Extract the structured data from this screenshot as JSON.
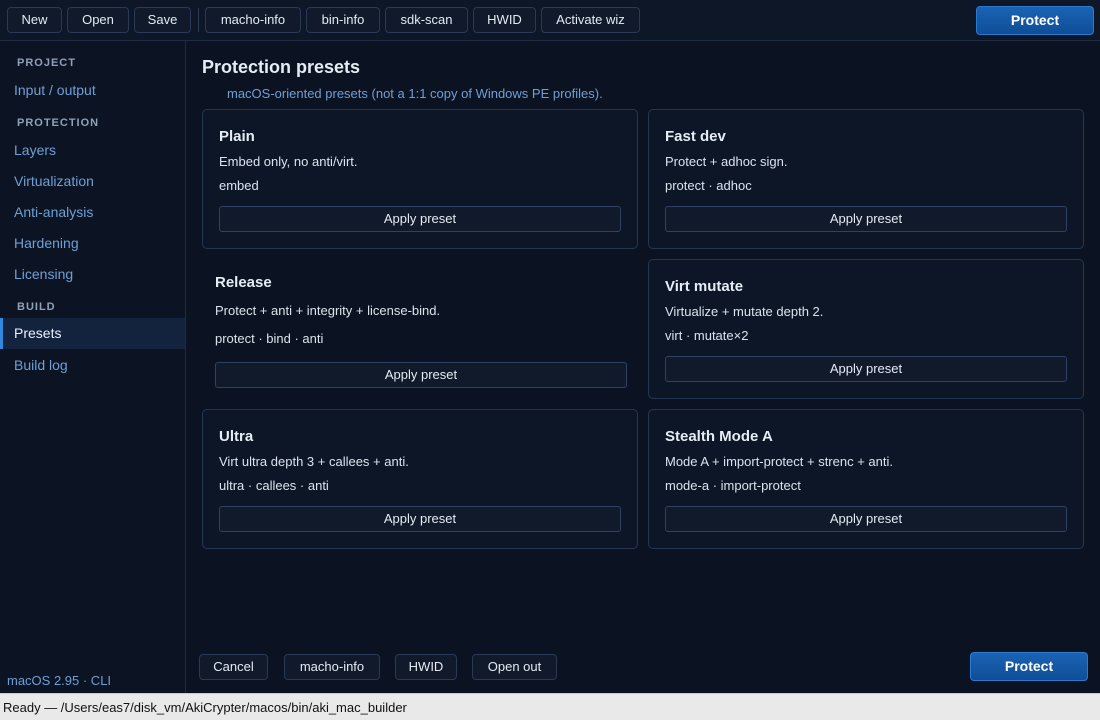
{
  "toolbar": {
    "buttons": [
      "New",
      "Open",
      "Save",
      "macho-info",
      "bin-info",
      "sdk-scan",
      "HWID",
      "Activate wiz"
    ],
    "protect_label": "Protect"
  },
  "sidebar": {
    "sections": [
      {
        "heading": "PROJECT",
        "items": [
          "Input / output"
        ]
      },
      {
        "heading": "PROTECTION",
        "items": [
          "Layers",
          "Virtualization",
          "Anti-analysis",
          "Hardening",
          "Licensing"
        ]
      },
      {
        "heading": "BUILD",
        "items": [
          "Presets",
          "Build log"
        ]
      }
    ],
    "active_item": "Presets",
    "version": "macOS 2.95 · CLI"
  },
  "main": {
    "title": "Protection presets",
    "subtitle": "macOS-oriented presets (not a 1:1 copy of Windows PE profiles).",
    "apply_label": "Apply preset",
    "presets": [
      {
        "name": "Plain",
        "description": "Embed only, no anti/virt.",
        "tags": "embed"
      },
      {
        "name": "Fast dev",
        "description": "Protect + adhoc sign.",
        "tags": "protect · adhoc"
      },
      {
        "name": "Release",
        "description": "Protect + anti + integrity + license-bind.",
        "tags": "protect · bind · anti"
      },
      {
        "name": "Virt mutate",
        "description": "Virtualize + mutate depth 2.",
        "tags": "virt · mutate×2"
      },
      {
        "name": "Ultra",
        "description": "Virt ultra depth 3 + callees + anti.",
        "tags": "ultra · callees · anti"
      },
      {
        "name": "Stealth Mode A",
        "description": "Mode A + import-protect + strenc + anti.",
        "tags": "mode-a · import-protect"
      }
    ]
  },
  "bottom_bar": {
    "buttons": [
      "Cancel",
      "macho-info",
      "HWID",
      "Open out"
    ],
    "protect_label": "Protect"
  },
  "status": {
    "text": "Ready — /Users/eas7/disk_vm/AkiCrypter/macos/bin/aki_mac_builder"
  }
}
